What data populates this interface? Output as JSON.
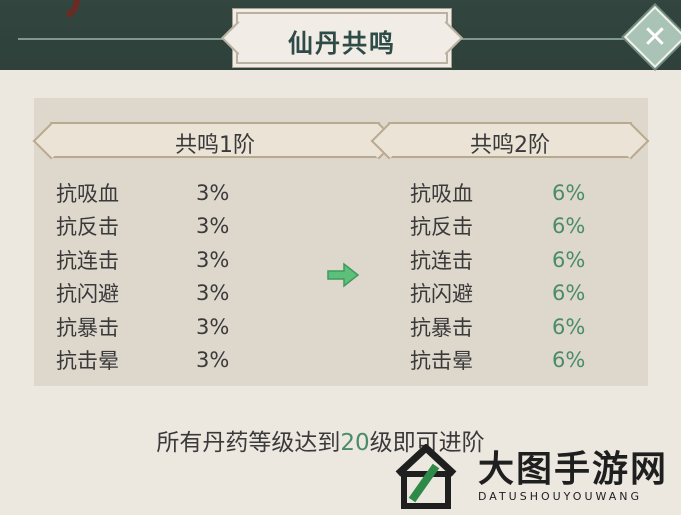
{
  "dialog": {
    "title": "仙丹共鸣",
    "close_label": "✕"
  },
  "tiers": {
    "current": {
      "label": "共鸣1阶",
      "stats": [
        {
          "name": "抗吸血",
          "value": "3%"
        },
        {
          "name": "抗反击",
          "value": "3%"
        },
        {
          "name": "抗连击",
          "value": "3%"
        },
        {
          "name": "抗闪避",
          "value": "3%"
        },
        {
          "name": "抗暴击",
          "value": "3%"
        },
        {
          "name": "抗击晕",
          "value": "3%"
        }
      ]
    },
    "next": {
      "label": "共鸣2阶",
      "stats": [
        {
          "name": "抗吸血",
          "value": "6%"
        },
        {
          "name": "抗反击",
          "value": "6%"
        },
        {
          "name": "抗连击",
          "value": "6%"
        },
        {
          "name": "抗闪避",
          "value": "6%"
        },
        {
          "name": "抗暴击",
          "value": "6%"
        },
        {
          "name": "抗击晕",
          "value": "6%"
        }
      ]
    }
  },
  "requirement": {
    "prefix": "所有丹药等级达到",
    "level": "20",
    "suffix": "级即可进阶"
  },
  "watermark": {
    "title": "大图手游网",
    "subtitle": "DATUSHOUYOUWANG"
  },
  "colors": {
    "accent_green": "#4a8c6a",
    "panel": "#ece7df",
    "title_text": "#2f4b47"
  }
}
